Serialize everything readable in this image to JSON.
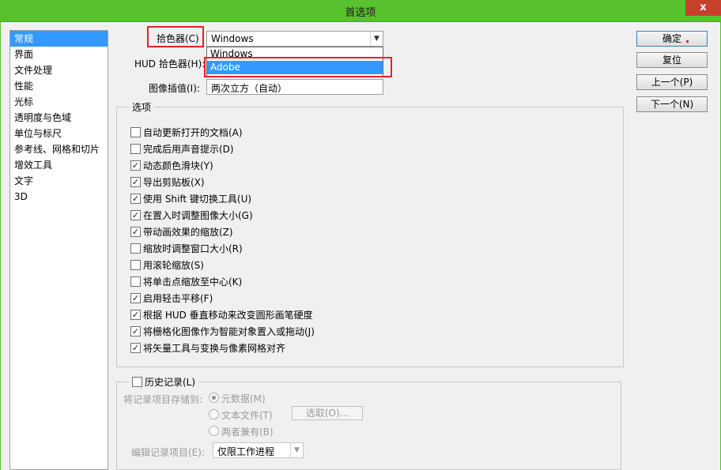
{
  "window": {
    "title": "首选项",
    "close": "x"
  },
  "nav": [
    "常规",
    "界面",
    "文件处理",
    "性能",
    "光标",
    "透明度与色域",
    "单位与标尺",
    "参考线、网格和切片",
    "增效工具",
    "文字",
    "3D"
  ],
  "nav_selected": 0,
  "fields": {
    "color_picker_label": "拾色器(C)",
    "color_picker_value": "Windows",
    "hud_picker_label": "HUD 拾色器(H):",
    "interp_label": "图像插值(I):",
    "interp_value": "两次立方（自动）"
  },
  "dropdown": {
    "options": [
      "Windows",
      "Adobe"
    ],
    "highlighted": 1
  },
  "buttons": {
    "ok": "确定",
    "reset": "复位",
    "prev": "上一个(P)",
    "next": "下一个(N)"
  },
  "options_group": {
    "title": "选项",
    "items": [
      {
        "label": "自动更新打开的文档(A)",
        "checked": false
      },
      {
        "label": "完成后用声音提示(D)",
        "checked": false
      },
      {
        "label": "动态颜色滑块(Y)",
        "checked": true
      },
      {
        "label": "导出剪贴板(X)",
        "checked": true
      },
      {
        "label": "使用 Shift 键切换工具(U)",
        "checked": true
      },
      {
        "label": "在置入时调整图像大小(G)",
        "checked": true
      },
      {
        "label": "带动画效果的缩放(Z)",
        "checked": true
      },
      {
        "label": "缩放时调整窗口大小(R)",
        "checked": false
      },
      {
        "label": "用滚轮缩放(S)",
        "checked": false
      },
      {
        "label": "将单击点缩放至中心(K)",
        "checked": false
      },
      {
        "label": "启用轻击平移(F)",
        "checked": true
      },
      {
        "label": "根据 HUD 垂直移动来改变圆形画笔硬度",
        "checked": true
      },
      {
        "label": "将栅格化图像作为智能对象置入或拖动(J)",
        "checked": true
      },
      {
        "label": "将矢量工具与变换与像素网格对齐",
        "checked": true
      }
    ]
  },
  "history": {
    "title": "历史记录(L)",
    "checked": false,
    "save_to_label": "将记录项目存储到:",
    "radio_metadata": "元数据(M)",
    "radio_textfile": "文本文件(T)",
    "radio_both": "两者兼有(B)",
    "choose_button": "选取(O)...",
    "edit_log_label": "编辑记录项目(E):",
    "edit_log_value": "仅限工作进程"
  },
  "colors": {
    "titlebar": "#57c22e",
    "selection": "#3399ff",
    "highlight_box": "#e8212c"
  }
}
